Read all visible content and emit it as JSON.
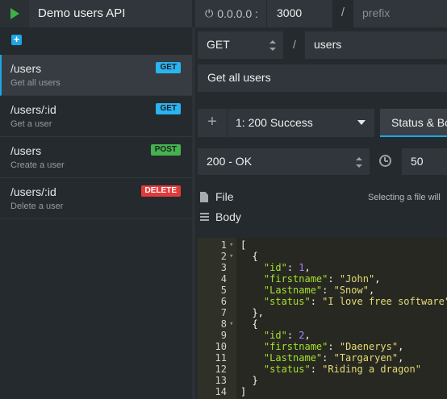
{
  "topbar": {
    "env_name": "Demo users API",
    "hostname": "0.0.0.0 :",
    "port": "3000",
    "slash": "/",
    "prefix_placeholder": "prefix"
  },
  "sidebar": {
    "add_route_glyph": "+",
    "routes": [
      {
        "path": "/users",
        "desc": "Get all users",
        "method": "GET"
      },
      {
        "path": "/users/:id",
        "desc": "Get a user",
        "method": "GET"
      },
      {
        "path": "/users",
        "desc": "Create a user",
        "method": "POST"
      },
      {
        "path": "/users/:id",
        "desc": "Delete a user",
        "method": "DELETE"
      }
    ]
  },
  "route_editor": {
    "method": "GET",
    "slash": "/",
    "endpoint": "users",
    "documentation": "Get all users"
  },
  "response": {
    "add_glyph": "+",
    "selected": "1: 200  Success",
    "tab_label": "Status & Body",
    "status": "200 - OK",
    "latency": "50",
    "file_label": "File",
    "file_hint": "Selecting a file will",
    "body_label": "Body"
  },
  "editor": {
    "lines": [
      {
        "n": "1",
        "fold": true,
        "tokens": [
          {
            "t": "p",
            "v": "["
          }
        ]
      },
      {
        "n": "2",
        "fold": true,
        "tokens": [
          {
            "t": "p",
            "v": "  {"
          }
        ]
      },
      {
        "n": "3",
        "fold": false,
        "tokens": [
          {
            "t": "p",
            "v": "    "
          },
          {
            "t": "k",
            "v": "\"id\""
          },
          {
            "t": "p",
            "v": ": "
          },
          {
            "t": "n",
            "v": "1"
          },
          {
            "t": "p",
            "v": ","
          }
        ]
      },
      {
        "n": "4",
        "fold": false,
        "tokens": [
          {
            "t": "p",
            "v": "    "
          },
          {
            "t": "k",
            "v": "\"firstname\""
          },
          {
            "t": "p",
            "v": ": "
          },
          {
            "t": "s",
            "v": "\"John\""
          },
          {
            "t": "p",
            "v": ","
          }
        ]
      },
      {
        "n": "5",
        "fold": false,
        "tokens": [
          {
            "t": "p",
            "v": "    "
          },
          {
            "t": "k",
            "v": "\"Lastname\""
          },
          {
            "t": "p",
            "v": ": "
          },
          {
            "t": "s",
            "v": "\"Snow\""
          },
          {
            "t": "p",
            "v": ","
          }
        ]
      },
      {
        "n": "6",
        "fold": false,
        "tokens": [
          {
            "t": "p",
            "v": "    "
          },
          {
            "t": "k",
            "v": "\"status\""
          },
          {
            "t": "p",
            "v": ": "
          },
          {
            "t": "s",
            "v": "\"I love free software\""
          }
        ]
      },
      {
        "n": "7",
        "fold": false,
        "tokens": [
          {
            "t": "p",
            "v": "  },"
          }
        ]
      },
      {
        "n": "8",
        "fold": true,
        "tokens": [
          {
            "t": "p",
            "v": "  {"
          }
        ]
      },
      {
        "n": "9",
        "fold": false,
        "tokens": [
          {
            "t": "p",
            "v": "    "
          },
          {
            "t": "k",
            "v": "\"id\""
          },
          {
            "t": "p",
            "v": ": "
          },
          {
            "t": "n",
            "v": "2"
          },
          {
            "t": "p",
            "v": ","
          }
        ]
      },
      {
        "n": "10",
        "fold": false,
        "tokens": [
          {
            "t": "p",
            "v": "    "
          },
          {
            "t": "k",
            "v": "\"firstname\""
          },
          {
            "t": "p",
            "v": ": "
          },
          {
            "t": "s",
            "v": "\"Daenerys\""
          },
          {
            "t": "p",
            "v": ","
          }
        ]
      },
      {
        "n": "11",
        "fold": false,
        "tokens": [
          {
            "t": "p",
            "v": "    "
          },
          {
            "t": "k",
            "v": "\"Lastname\""
          },
          {
            "t": "p",
            "v": ": "
          },
          {
            "t": "s",
            "v": "\"Targaryen\""
          },
          {
            "t": "p",
            "v": ","
          }
        ]
      },
      {
        "n": "12",
        "fold": false,
        "tokens": [
          {
            "t": "p",
            "v": "    "
          },
          {
            "t": "k",
            "v": "\"status\""
          },
          {
            "t": "p",
            "v": ": "
          },
          {
            "t": "s",
            "v": "\"Riding a dragon\""
          }
        ]
      },
      {
        "n": "13",
        "fold": false,
        "tokens": [
          {
            "t": "p",
            "v": "  }"
          }
        ]
      },
      {
        "n": "14",
        "fold": false,
        "tokens": [
          {
            "t": "p",
            "v": "]"
          }
        ]
      }
    ]
  },
  "colors": {
    "accent": "#1ea7e4",
    "get_badge": "#2ab4f0",
    "post_badge": "#46b24d",
    "delete_badge": "#e23b3b",
    "start_button": "#3fb045"
  }
}
